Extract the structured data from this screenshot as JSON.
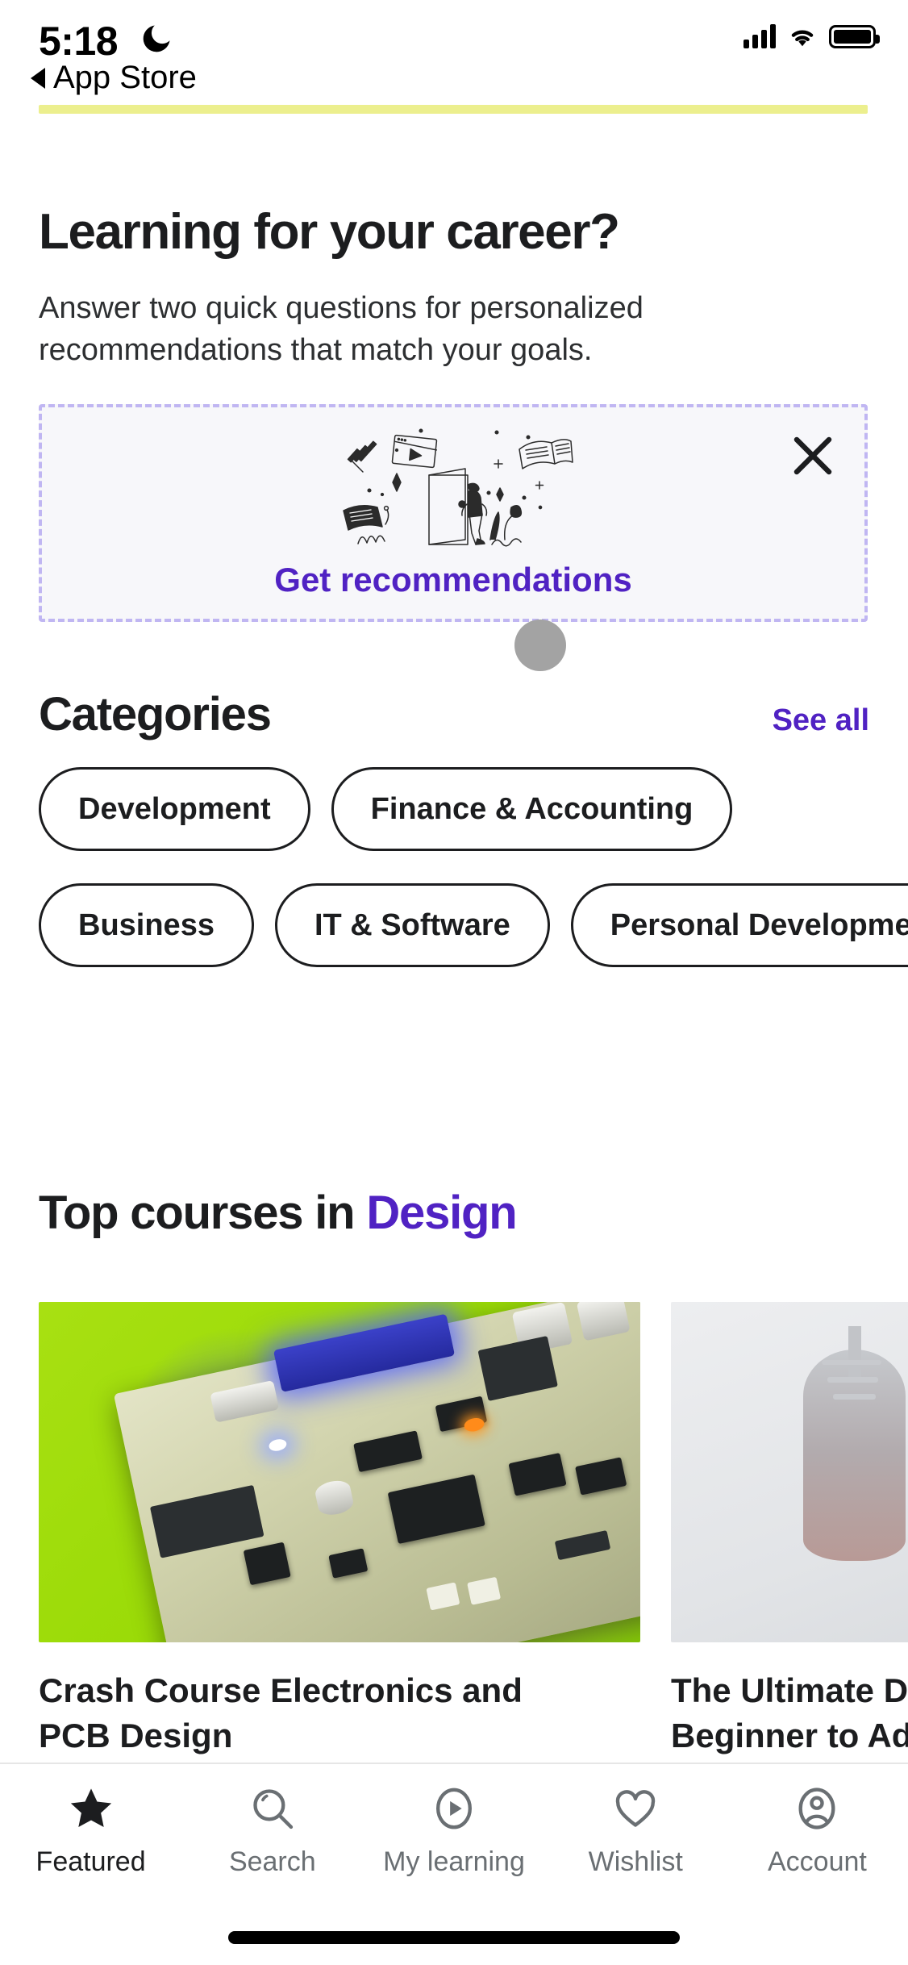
{
  "status_bar": {
    "time": "5:18",
    "dnd_icon": "crescent-moon-icon",
    "signal_icon": "cellular-signal-icon",
    "wifi_icon": "wifi-icon",
    "battery_icon": "battery-full-icon"
  },
  "back_link": {
    "label": "App Store",
    "icon": "back-triangle-icon"
  },
  "loading_bar": {
    "color": "#ecef8e"
  },
  "promo": {
    "heading": "Learning for your career?",
    "subtitle": "Answer two quick questions for personalized recommendations that match your goals.",
    "cta_label": "Get recommendations",
    "close_icon": "close-x-icon",
    "illustration": "person-walking-through-door-illustration",
    "accent_color": "#5022c3",
    "border_color": "#c0b6f2",
    "background_color": "#f7f7fa"
  },
  "categories": {
    "title": "Categories",
    "see_all_label": "See all",
    "row1": [
      {
        "label": "Development"
      },
      {
        "label": "Finance & Accounting"
      }
    ],
    "row2": [
      {
        "label": "Business"
      },
      {
        "label": "IT & Software"
      },
      {
        "label": "Personal Development"
      }
    ]
  },
  "top_courses": {
    "title_prefix": "Top courses in ",
    "title_highlight": "Design",
    "highlight_color": "#5022c3",
    "courses": [
      {
        "title": "Crash Course Electronics and PCB Design",
        "image": "circuit-board-on-green-background"
      },
      {
        "title": "The Ultimate Drawing Course - Beginner to Advanced",
        "image": "digital-illustration-of-person"
      }
    ]
  },
  "tab_bar": {
    "tabs": [
      {
        "label": "Featured",
        "icon": "star-icon",
        "active": true
      },
      {
        "label": "Search",
        "icon": "magnifier-icon",
        "active": false
      },
      {
        "label": "My learning",
        "icon": "play-circle-icon",
        "active": false
      },
      {
        "label": "Wishlist",
        "icon": "heart-icon",
        "active": false
      },
      {
        "label": "Account",
        "icon": "person-circle-icon",
        "active": false
      }
    ]
  }
}
